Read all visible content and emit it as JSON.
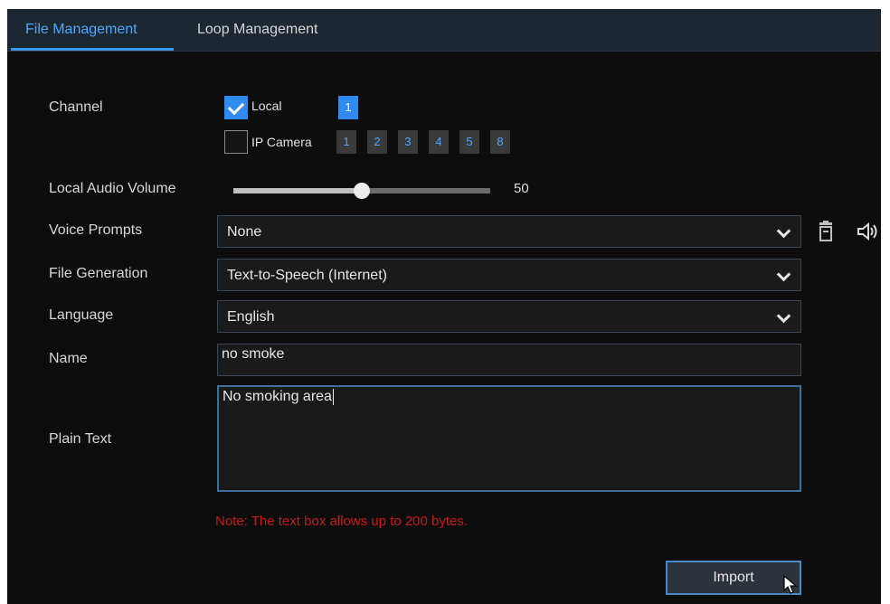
{
  "tabs": [
    {
      "label": "File Management",
      "active": true
    },
    {
      "label": "Loop Management",
      "active": false
    }
  ],
  "channel": {
    "label": "Channel",
    "local": {
      "label": "Local",
      "checked": true,
      "channels": [
        "1"
      ]
    },
    "ip_camera": {
      "label": "IP Camera",
      "checked": false,
      "channels": [
        "1",
        "2",
        "3",
        "4",
        "5",
        "8"
      ]
    }
  },
  "audio_volume": {
    "label": "Local Audio Volume",
    "value": "50",
    "level": 0.5
  },
  "voice_prompts": {
    "label": "Voice Prompts",
    "value": "None"
  },
  "file_generation": {
    "label": "File Generation",
    "value": "Text-to-Speech (Internet)"
  },
  "language": {
    "label": "Language",
    "value": "English"
  },
  "name": {
    "label": "Name",
    "value": "no smoke"
  },
  "plain_text": {
    "label": "Plain Text",
    "value": "No smoking area"
  },
  "note": "Note: The text box allows up to 200 bytes.",
  "import_button": "Import",
  "colors": {
    "accent": "#2f8bf0",
    "note": "#c81818",
    "background": "#0d0d0d"
  },
  "icons": [
    "checkbox-checked-icon",
    "checkbox-unchecked-icon",
    "chevron-down-icon",
    "trash-icon",
    "speaker-icon",
    "mouse-cursor-icon"
  ]
}
